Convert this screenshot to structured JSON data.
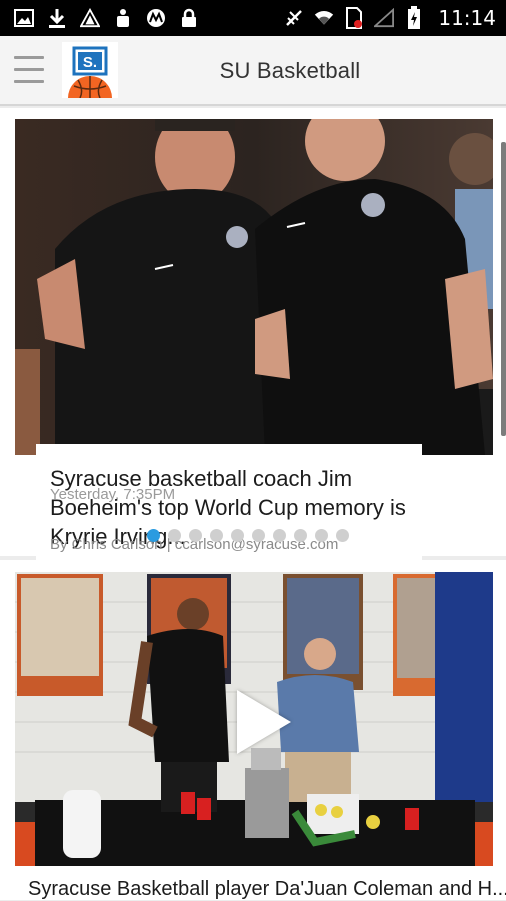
{
  "status_bar": {
    "time": "11:14",
    "left_icons": [
      "image-icon",
      "download-icon",
      "triangle-icon",
      "usb-icon",
      "motorola-icon",
      "lock-icon"
    ],
    "right_icons": [
      "no-signal-icon",
      "wifi-icon",
      "sim-icon",
      "cell-signal-icon",
      "battery-charging-icon"
    ]
  },
  "app_bar": {
    "title": "SU Basketball",
    "logo_letter": "S."
  },
  "featured": {
    "headline": "Syracuse basketball coach Jim Boeheim's top World Cup memory is Kryrie Irving...",
    "byline": "By Chris Carlson | ccarlson@syracuse.com",
    "timestamp": "Yesterday, 7:35PM",
    "carousel_count": 10,
    "carousel_active": 0
  },
  "video_story": {
    "headline": "Syracuse Basketball player Da'Juan Coleman and H..."
  },
  "colors": {
    "accent": "#2a9be0",
    "orange": "#f26522",
    "blue": "#1e73be"
  }
}
